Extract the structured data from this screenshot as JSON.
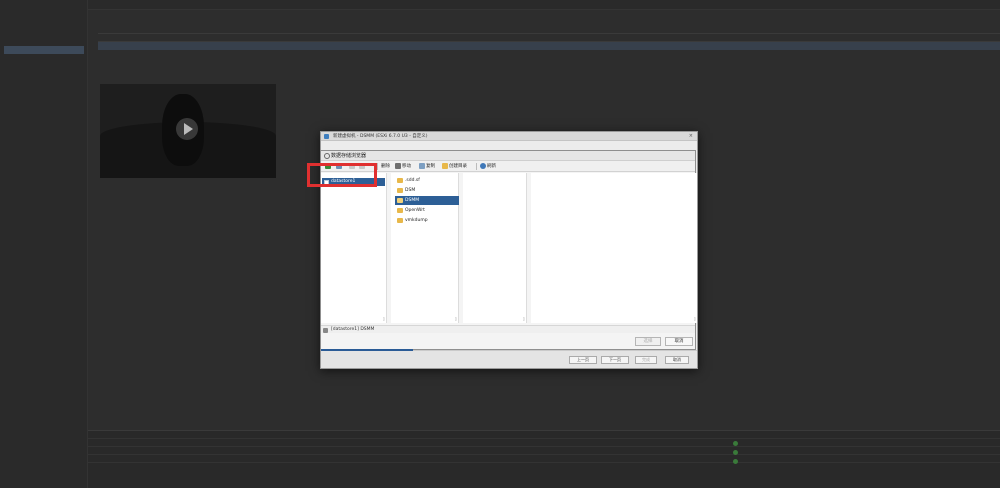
{
  "modal": {
    "title": "数据存储浏览器",
    "toolbar": {
      "delete": "删除",
      "move": "移动",
      "copy": "复制",
      "new_folder": "创建目录",
      "refresh": "刷新"
    },
    "datastores": [
      {
        "name": "datastore1"
      }
    ],
    "folders": [
      {
        "name": ".sdd.sf",
        "selected": false
      },
      {
        "name": "DSM",
        "selected": false
      },
      {
        "name": "DSMM",
        "selected": true
      },
      {
        "name": "OpenWrt",
        "selected": false
      },
      {
        "name": "vmkdump",
        "selected": false
      }
    ],
    "path": "[datastore1] DSMM",
    "select_button": "选择",
    "cancel_button": "取消"
  },
  "wizard": {
    "title": "新建虚拟机 - DSMM (ESXi 6.7.0 U3 - 自定义)",
    "back_button": "上一页",
    "next_button": "下一页",
    "finish_button": "完成",
    "cancel_button": "取消"
  },
  "colors": {
    "selection": "#2d5f96",
    "highlight_box": "#e03030",
    "folder": "#e8b84a"
  }
}
